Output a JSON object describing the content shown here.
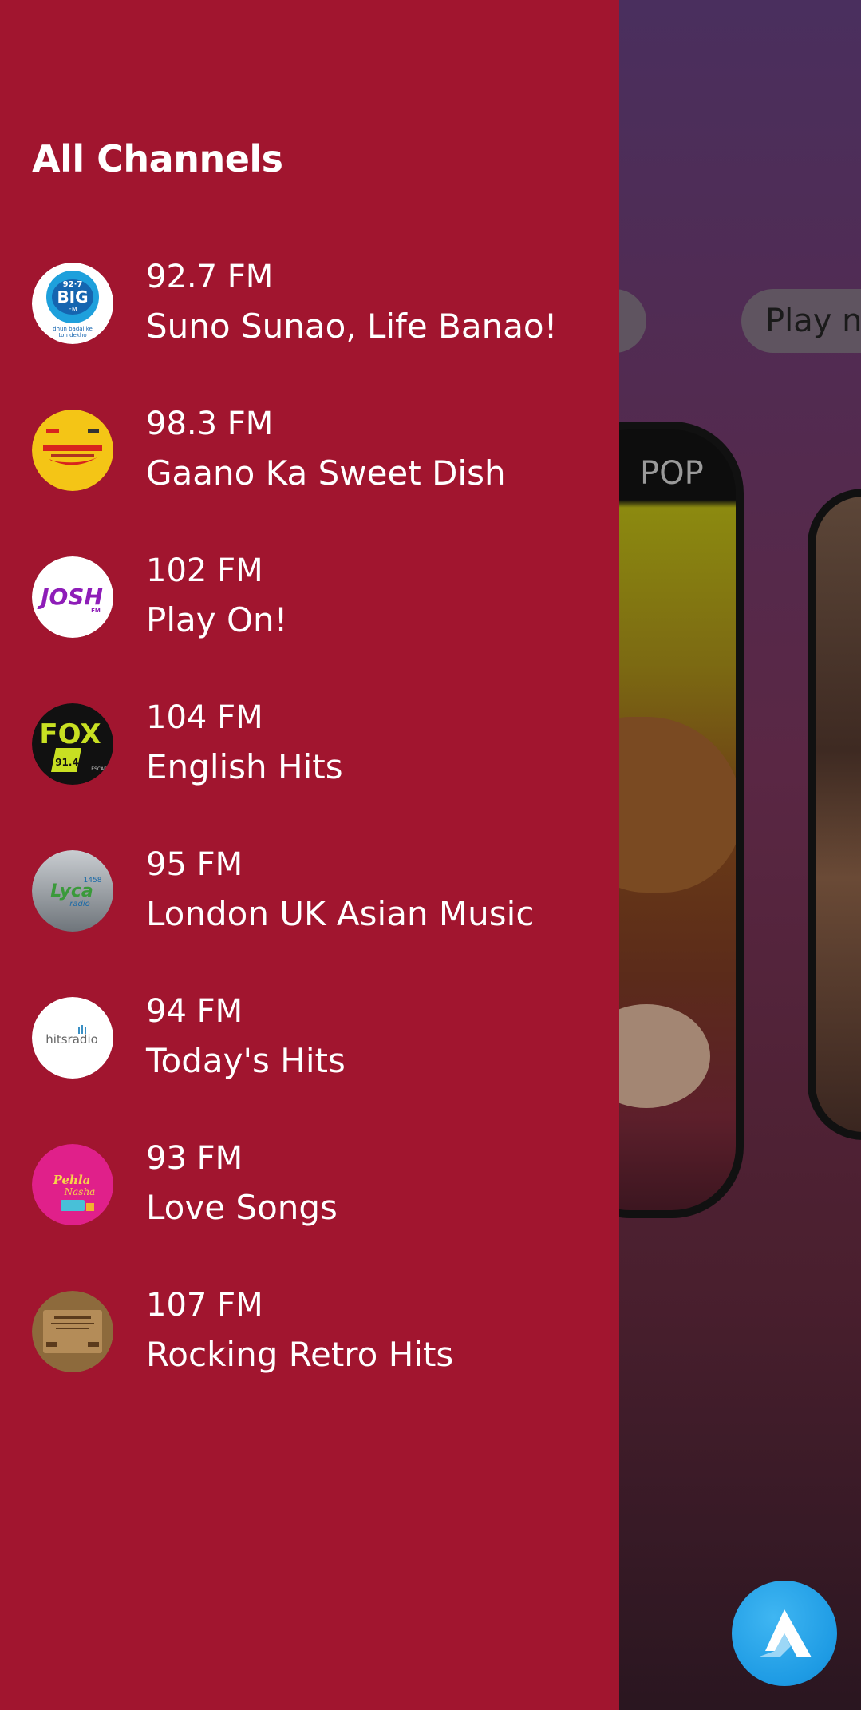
{
  "drawer": {
    "title": "All Channels",
    "channels": [
      {
        "frequency": "92.7 FM",
        "tagline": "Suno Sunao, Life Banao!",
        "logo_icon": "big-fm-logo-icon"
      },
      {
        "frequency": "98.3 FM",
        "tagline": "Gaano Ka Sweet Dish",
        "logo_icon": "radio-mirchi-logo-icon"
      },
      {
        "frequency": "102 FM",
        "tagline": "Play On!",
        "logo_icon": "josh-fm-logo-icon"
      },
      {
        "frequency": "104 FM",
        "tagline": "English Hits",
        "logo_icon": "fox-fm-logo-icon"
      },
      {
        "frequency": "95 FM",
        "tagline": "London UK Asian Music",
        "logo_icon": "lyca-radio-logo-icon"
      },
      {
        "frequency": "94 FM",
        "tagline": "Today's Hits",
        "logo_icon": "hits-radio-logo-icon"
      },
      {
        "frequency": "93 FM",
        "tagline": "Love Songs",
        "logo_icon": "pehla-nasha-logo-icon"
      },
      {
        "frequency": "107 FM",
        "tagline": "Rocking Retro Hits",
        "logo_icon": "retro-radio-logo-icon"
      }
    ]
  },
  "background": {
    "chip_left_label": "",
    "chip_right_label": "Play n",
    "card_label": "POP"
  },
  "colors": {
    "drawer_background": "#a1152f",
    "app_background_top": "#4a2f5e",
    "app_background_bottom": "#2a1620",
    "fab_blue": "#1e9be4"
  }
}
